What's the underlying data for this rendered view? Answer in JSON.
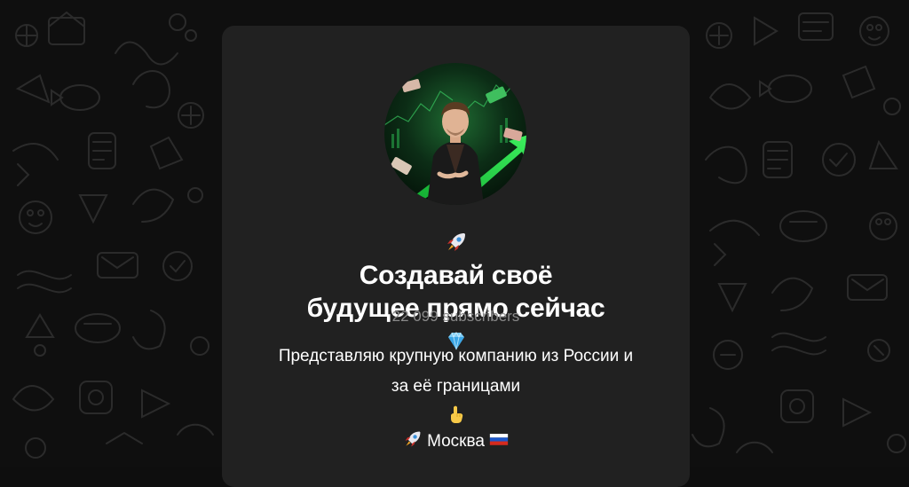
{
  "channel": {
    "title_line1": "Создавай своё",
    "title_line2": "будущее прямо сейчас",
    "subscribers": "22 099 subscribers",
    "description_line1": "Представляю крупную компанию из России и",
    "description_line2": "за её границами",
    "location": "Москва"
  },
  "icons": {
    "title_prefix": "rocket-icon",
    "title_suffix": "diamond-icon",
    "description_suffix": "pointing-up-icon",
    "location_prefix": "rocket-icon",
    "location_suffix": "russia-flag-icon"
  },
  "colors": {
    "background": "#0f0f0f",
    "card": "#212121",
    "text": "#ffffff",
    "muted": "#8a8a8a",
    "accent_green": "#22c24a"
  }
}
